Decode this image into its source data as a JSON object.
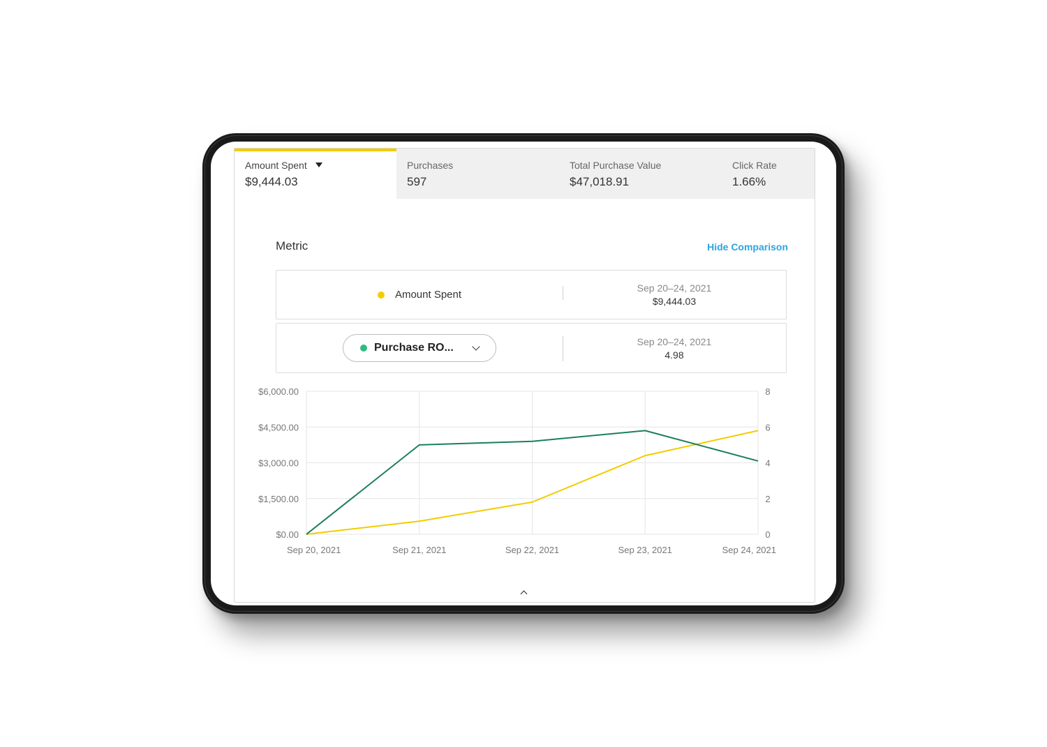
{
  "tabs": [
    {
      "label": "Amount Spent",
      "value": "$9,444.03",
      "active": true
    },
    {
      "label": "Purchases",
      "value": "597"
    },
    {
      "label": "Total Purchase Value",
      "value": "$47,018.91"
    },
    {
      "label": "Click Rate",
      "value": "1.66%"
    }
  ],
  "metric": {
    "title": "Metric",
    "hide_comparison": "Hide Comparison",
    "rows": [
      {
        "label": "Amount Spent",
        "date_range": "Sep 20–24, 2021",
        "value": "$9,444.03",
        "dot_color": "#f2cc00"
      },
      {
        "label": "Purchase RO...",
        "date_range": "Sep 20–24, 2021",
        "value": "4.98",
        "dot_color": "#2bbd7e",
        "dropdown": true
      }
    ]
  },
  "chart_data": {
    "type": "line",
    "x": [
      "Sep 20, 2021",
      "Sep 21, 2021",
      "Sep 22, 2021",
      "Sep 23, 2021",
      "Sep 24, 2021"
    ],
    "series": [
      {
        "name": "Amount Spent",
        "axis": "left",
        "color": "#f2cc00",
        "values": [
          0,
          550,
          1350,
          3300,
          4350
        ]
      },
      {
        "name": "Purchase RO...",
        "axis": "right",
        "color": "#1b7f5a",
        "values": [
          0,
          5.0,
          5.2,
          5.8,
          4.1
        ]
      }
    ],
    "y_left": {
      "ticks": [
        "$0.00",
        "$1,500.00",
        "$3,000.00",
        "$4,500.00",
        "$6,000.00"
      ],
      "range": [
        0,
        6000
      ]
    },
    "y_right": {
      "ticks": [
        "0",
        "2",
        "4",
        "6",
        "8"
      ],
      "range": [
        0,
        8
      ]
    },
    "grid": true
  }
}
